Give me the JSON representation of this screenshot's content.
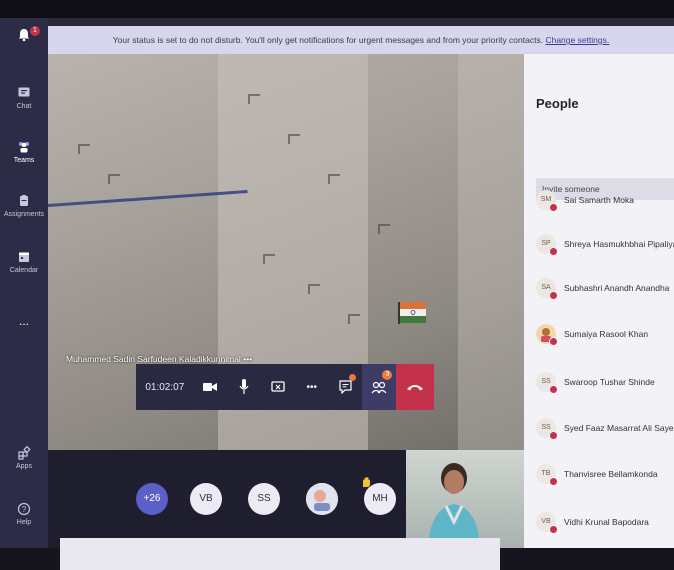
{
  "banner": {
    "message": "Your status is set to do not disturb. You'll only get notifications for urgent messages and from your priority contacts.",
    "link": "Change settings."
  },
  "rail": {
    "activity_badge": "1",
    "items": [
      {
        "label": "Chat"
      },
      {
        "label": "Teams"
      },
      {
        "label": "Assignments"
      },
      {
        "label": "Calendar"
      },
      {
        "label": "..."
      },
      {
        "label": "Apps"
      },
      {
        "label": "Help"
      }
    ]
  },
  "call": {
    "speaker_name": "Muhammed Sadin Sarfudeen Kaladikkunnimal",
    "speaker_more": "•••",
    "elapsed": "01:02:07",
    "participants_badge": "3",
    "more_dots": "•••"
  },
  "strip": {
    "overflow": "+26",
    "avatars": [
      "VB",
      "SS",
      "MH"
    ]
  },
  "people": {
    "title": "People",
    "invite_placeholder": "Invite someone",
    "list": [
      {
        "initials": "SM",
        "name": "Sai Samarth Moka"
      },
      {
        "initials": "SP",
        "name": "Shreya Hasmukhbhai Pipaliya"
      },
      {
        "initials": "SA",
        "name": "Subhashri Anandh Anandha"
      },
      {
        "initials": "",
        "name": "Sumaiya Rasool Khan"
      },
      {
        "initials": "SS",
        "name": "Swaroop Tushar Shinde"
      },
      {
        "initials": "SS",
        "name": "Syed Faaz Masarrat Ali Saye"
      },
      {
        "initials": "TB",
        "name": "Thanvisree Bellamkonda"
      },
      {
        "initials": "VB",
        "name": "Vidhi Krunal Bapodara"
      }
    ]
  },
  "colors": {
    "rail": "#2d2c46",
    "toolbar": "#2a2942",
    "hangup": "#c4314b",
    "accent": "#5b5fc7"
  }
}
